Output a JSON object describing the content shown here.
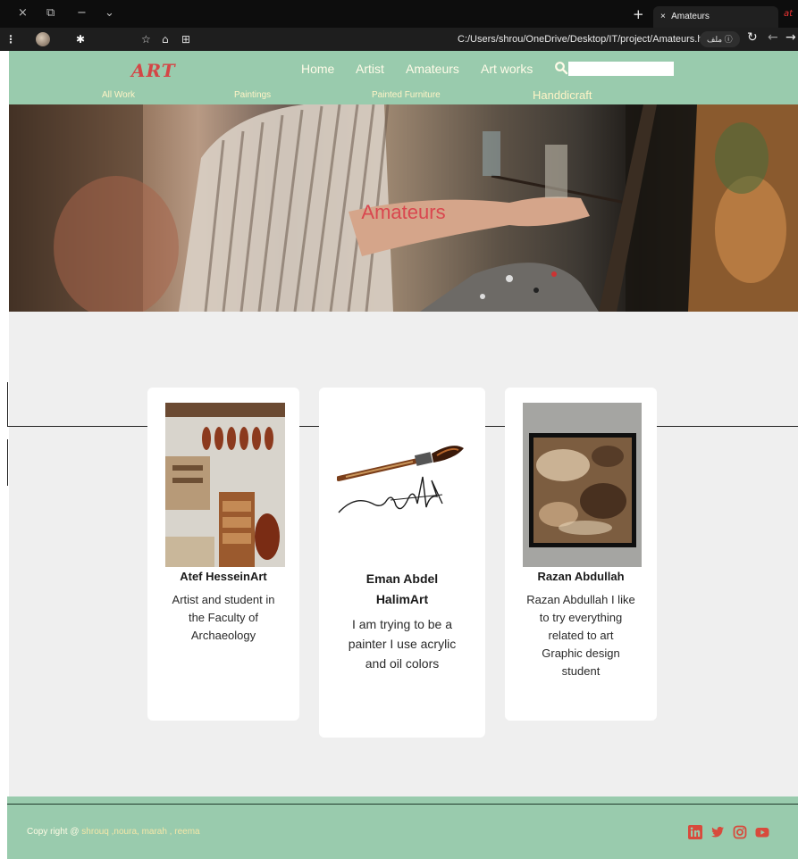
{
  "browser": {
    "tab_title": "Amateurs",
    "tab_close": "×",
    "new_tab": "+",
    "window_controls": [
      "×",
      "⧉",
      "−",
      "⌄"
    ],
    "url": "C:/Users/shrou/OneDrive/Desktop/IT/project/Amateurs.html",
    "url_badge": "ملف ⓘ",
    "extension_label": "at"
  },
  "header": {
    "logo": "ART",
    "nav": [
      "Home",
      "Artist",
      "Amateurs",
      "Art works"
    ],
    "search_placeholder": "",
    "subnav": [
      "All Work",
      "Paintings",
      "Painted Furniture",
      "Handdicraft"
    ]
  },
  "hero": {
    "title": "Amateurs"
  },
  "cards": [
    {
      "name": "Atef HesseinArt",
      "description": "Artist and student in the Faculty of Archaeology",
      "image": "violin-workshop-photo"
    },
    {
      "name": "Eman Abdel HalimArt",
      "description": "I am trying to be a painter I use acrylic and oil colors",
      "image": "paintbrush-signature-drawing"
    },
    {
      "name": "Razan Abdullah",
      "description": "Razan Abdullah I like to try everything related to art Graphic design student",
      "image": "framed-abstract-painting"
    }
  ],
  "footer": {
    "copyright_prefix": "Copy right @ ",
    "copyright_names": "shrouq ,noura, marah , reema",
    "social_icons": [
      "linkedin-icon",
      "twitter-icon",
      "instagram-icon",
      "youtube-icon"
    ]
  },
  "colors": {
    "header_bg": "#99cbad",
    "logo": "#d44646",
    "hero_title": "#d9474f",
    "nav_text": "#fffbe8",
    "social_icon": "#d84a3c",
    "page_bg": "#efefef"
  }
}
